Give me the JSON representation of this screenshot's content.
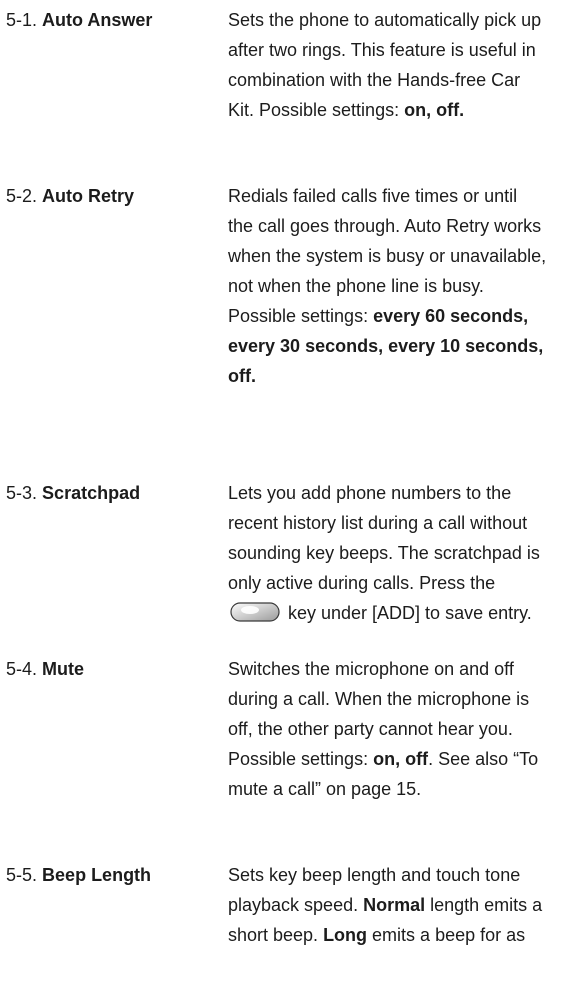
{
  "entries": [
    {
      "number": "5-1.",
      "title": "Auto Answer",
      "lines": [
        "Sets the phone to automatically pick up",
        "after two rings. This feature is useful in",
        "combination with the Hands-free Car",
        "Kit. Possible settings: "
      ],
      "bold_tail": "on, off."
    },
    {
      "number": "5-2.",
      "title": "Auto Retry",
      "lines": [
        "Redials failed calls five times or until",
        "the call goes through. Auto Retry works",
        "when the system is busy or unavailable,",
        "not when the phone line is busy.",
        "Possible settings: "
      ],
      "bold_lines": [
        "every 60 seconds,",
        "every 30 seconds, every 10 seconds,",
        "off."
      ]
    },
    {
      "number": "5-3.",
      "title": "Scratchpad",
      "lines": [
        "Lets you add phone numbers to the",
        "recent history list during a call without",
        "sounding key beeps. The scratchpad is",
        "only active during calls. Press the"
      ],
      "icon_line_text": "key under [ADD] to save entry.",
      "icon": "soft-key-icon"
    },
    {
      "number": "5-4.",
      "title": "Mute",
      "lines": [
        "Switches the microphone on and off",
        "during a call. When the microphone is",
        "off, the other party cannot hear you.",
        "Possible settings: ",
        "mute a call” on page 15."
      ],
      "bold_inline": "on, off",
      "after_bold": ". See also “To"
    },
    {
      "number": "5-5.",
      "title": "Beep Length",
      "lines": [
        "Sets key beep length and touch tone",
        "playback speed. ",
        " length emits a",
        "short beep. ",
        " emits a beep for as"
      ],
      "bold_words": [
        "Normal",
        "Long"
      ]
    }
  ]
}
